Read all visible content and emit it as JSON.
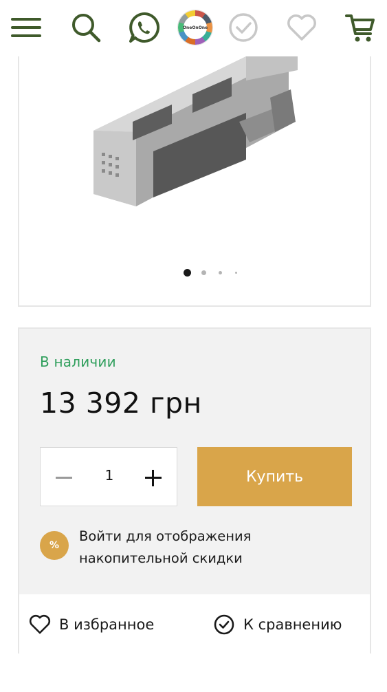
{
  "header": {
    "icons": [
      "menu-icon",
      "search-icon",
      "whatsapp-icon",
      "brand-logo",
      "compare-check-icon",
      "wishlist-heart-icon",
      "cart-icon"
    ],
    "logo_text": "OneOnOne"
  },
  "gallery": {
    "slide_count": 4,
    "active_slide": 1
  },
  "product": {
    "stock_status": "В наличии",
    "price": "13 392 грн",
    "quantity": "1",
    "buy_label": "Купить",
    "discount_badge": "%",
    "discount_line1": "Войти для отображения",
    "discount_line2": "накопительной скидки",
    "wishlist_label": "В избранное",
    "compare_label": "К сравнению"
  },
  "colors": {
    "accent_gold": "#d9a54a",
    "stock_green": "#2e9e5b",
    "header_icon_green": "#3f5a2b",
    "inactive_icon": "#c8c8c8"
  }
}
